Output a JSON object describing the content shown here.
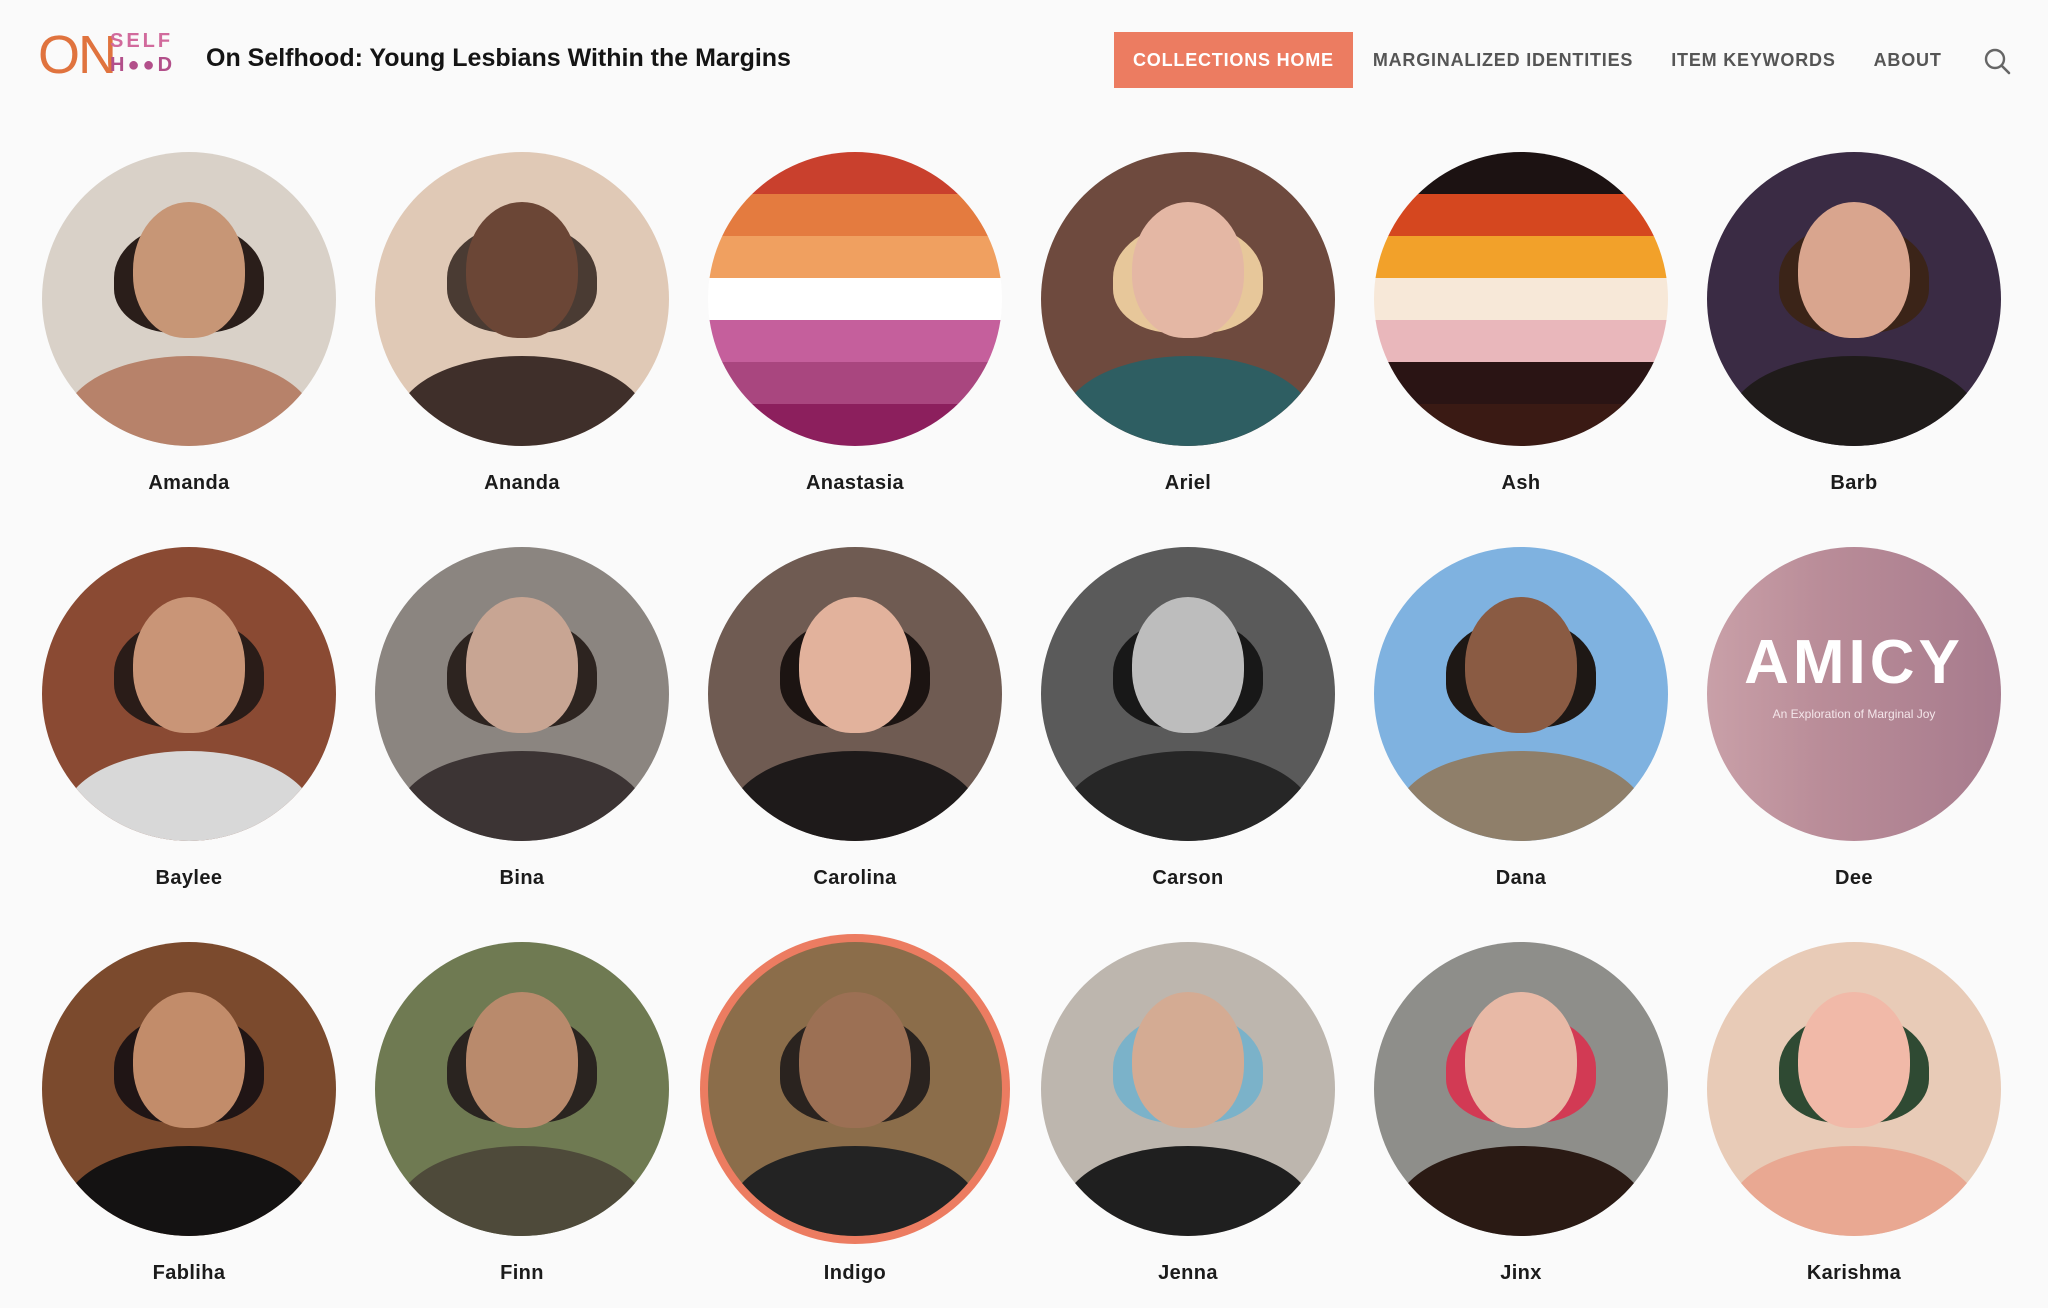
{
  "logo": {
    "on": "ON",
    "self": "SELF",
    "hood": "H●●D"
  },
  "site_title": "On Selfhood: Young Lesbians Within the Margins",
  "nav": {
    "items": [
      "COLLECTIONS HOME",
      "MARGINALIZED IDENTITIES",
      "ITEM KEYWORDS",
      "ABOUT"
    ],
    "active": "COLLECTIONS HOME"
  },
  "icons": {
    "search": "search-icon"
  },
  "amicy": {
    "title": "AMICY",
    "subtitle": "An Exploration of Marginal Joy"
  },
  "people": [
    {
      "name": "Amanda",
      "bg": "#d9d1c8",
      "hair": "#2a1e1a",
      "skin": "#c79676",
      "body": "#b7826a"
    },
    {
      "name": "Ananda",
      "bg": "#e0c9b6",
      "hair": "#4a3b33",
      "skin": "#6b4636",
      "body": "#3f2f2a"
    },
    {
      "name": "Anastasia",
      "flag": [
        "#c9402d",
        "#e47b3f",
        "#f0a060",
        "#ffffff",
        "#c55f9c",
        "#a9467f",
        "#8c1f5d"
      ]
    },
    {
      "name": "Ariel",
      "bg": "#6e4a3e",
      "hair": "#e7c79a",
      "skin": "#e4b7a4",
      "body": "#2e5e62"
    },
    {
      "name": "Ash",
      "flag": [
        "#1c1212",
        "#d5471f",
        "#f2a12a",
        "#f7e8d8",
        "#e9b7bb",
        "#2a1414",
        "#3a1a14"
      ]
    },
    {
      "name": "Barb",
      "bg": "#3a2b44",
      "hair": "#3b2418",
      "skin": "#d9a58e",
      "body": "#1f1b1a"
    },
    {
      "name": "Baylee",
      "bg": "#8a4a33",
      "hair": "#2a1c18",
      "skin": "#c99577",
      "body": "#d8d8d8"
    },
    {
      "name": "Bina",
      "bg": "#8b8580",
      "hair": "#2d2420",
      "skin": "#c8a593",
      "body": "#3c3434"
    },
    {
      "name": "Carolina",
      "bg": "#6f5b52",
      "hair": "#1c1412",
      "skin": "#e2b29c",
      "body": "#1e1a1a"
    },
    {
      "name": "Carson",
      "bg": "#5a5a5a",
      "hair": "#181818",
      "skin": "#bdbdbd",
      "body": "#262626"
    },
    {
      "name": "Dana",
      "bg": "#7fb2e0",
      "hair": "#1e1815",
      "skin": "#8a5b43",
      "body": "#8f7f6a"
    },
    {
      "name": "Dee",
      "amicy": true
    },
    {
      "name": "Fabliha",
      "bg": "#7b4a2d",
      "hair": "#201515",
      "skin": "#c28c6a",
      "body": "#141212"
    },
    {
      "name": "Finn",
      "bg": "#6f7a52",
      "hair": "#2a2420",
      "skin": "#b98a6c",
      "body": "#4e4a3a"
    },
    {
      "name": "Indigo",
      "bg": "#8b6d4a",
      "hair": "#2a231f",
      "skin": "#9c7054",
      "body": "#232323",
      "selected": true
    },
    {
      "name": "Jenna",
      "bg": "#bdb6ae",
      "hair": "#7bb2c9",
      "skin": "#d4ab93",
      "body": "#1f1f1f"
    },
    {
      "name": "Jinx",
      "bg": "#8e8e8a",
      "hair": "#d23a54",
      "skin": "#e8b9a6",
      "body": "#2a1a14"
    },
    {
      "name": "Karishma",
      "bg": "#e8cbb7",
      "hair": "#2f4a33",
      "skin": "#f1b9a8",
      "body": "#e9a892"
    }
  ]
}
